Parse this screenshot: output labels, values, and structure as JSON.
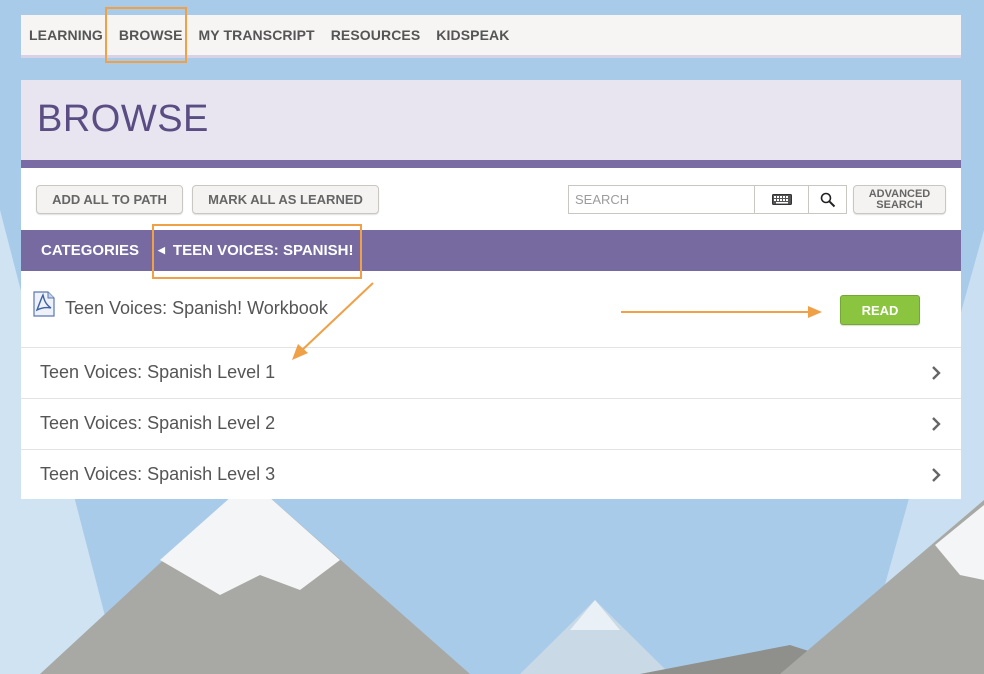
{
  "nav": {
    "items": [
      {
        "label": "LEARNING"
      },
      {
        "label": "BROWSE"
      },
      {
        "label": "MY TRANSCRIPT"
      },
      {
        "label": "RESOURCES"
      },
      {
        "label": "KIDSPEAK"
      }
    ]
  },
  "page": {
    "title": "BROWSE"
  },
  "toolbar": {
    "add_all_label": "ADD ALL TO PATH",
    "mark_all_label": "MARK ALL AS LEARNED",
    "search_placeholder": "SEARCH",
    "advanced_line1": "ADVANCED",
    "advanced_line2": "SEARCH"
  },
  "breadcrumb": {
    "categories": "CATEGORIES",
    "current": "TEEN VOICES: SPANISH!"
  },
  "file_item": {
    "label": "Teen Voices: Spanish! Workbook",
    "read_label": "READ",
    "icon": "pdf-icon"
  },
  "levels": [
    {
      "label": "Teen Voices: Spanish Level 1"
    },
    {
      "label": "Teen Voices: Spanish Level 2"
    },
    {
      "label": "Teen Voices: Spanish Level 3"
    }
  ],
  "colors": {
    "accent_purple": "#776aa1",
    "header_bg": "#e8e5f1",
    "read_green": "#8bc43f",
    "highlight_orange": "#f0a046",
    "sky": "#a9cbea"
  }
}
